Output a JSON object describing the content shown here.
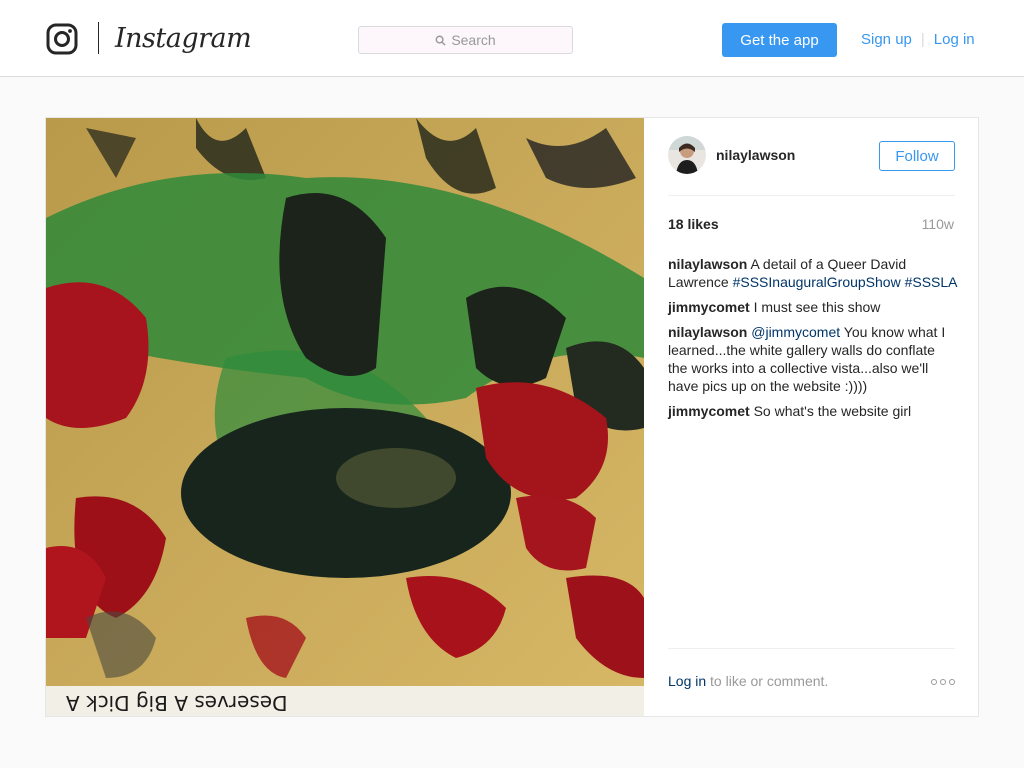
{
  "header": {
    "wordmark": "Instagram",
    "search_placeholder": "Search",
    "get_app_label": "Get the app",
    "sign_up_label": "Sign up",
    "log_in_label": "Log in",
    "accent_color": "#3897f0"
  },
  "post": {
    "photo_caption_text": "Deserves A Big Dick A",
    "author": "nilaylawson",
    "follow_label": "Follow",
    "likes": "18 likes",
    "age": "110w",
    "comments": [
      {
        "user": "nilaylawson",
        "parts": [
          {
            "text": " A detail of a Queer David Lawrence ",
            "type": "text"
          },
          {
            "text": "#SSSInauguralGroupShow",
            "type": "link"
          },
          {
            "text": " ",
            "type": "text"
          },
          {
            "text": "#SSSLA",
            "type": "link"
          }
        ]
      },
      {
        "user": "jimmycomet",
        "parts": [
          {
            "text": " I must see this show",
            "type": "text"
          }
        ]
      },
      {
        "user": "nilaylawson",
        "parts": [
          {
            "text": " ",
            "type": "text"
          },
          {
            "text": "@jimmycomet",
            "type": "link"
          },
          {
            "text": " You know what I learned...the white gallery walls do conflate the works into a collective vista...also we'll have pics up on the website :))))",
            "type": "text"
          }
        ]
      },
      {
        "user": "jimmycomet",
        "parts": [
          {
            "text": " So what's the website girl",
            "type": "text"
          }
        ]
      }
    ],
    "footer_login_label": "Log in",
    "footer_suffix": " to like or comment.",
    "more_icon": "more-options-icon"
  }
}
